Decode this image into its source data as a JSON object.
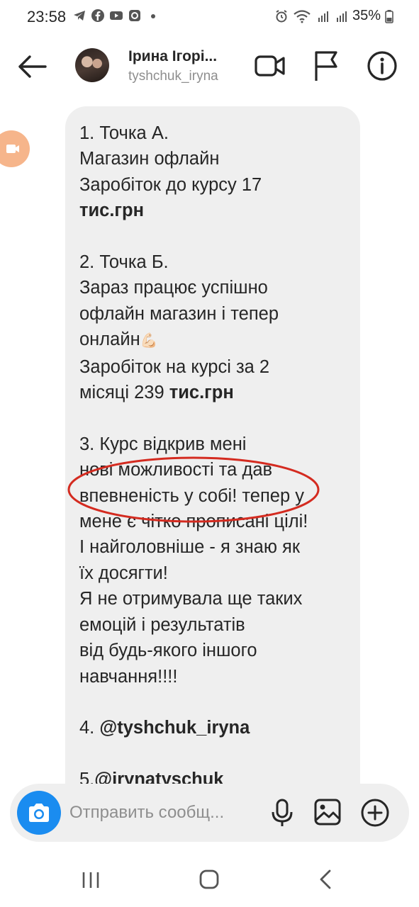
{
  "status_bar": {
    "time": "23:58",
    "battery": "35%"
  },
  "header": {
    "name": "Ірина Ігорі...",
    "handle": "tyshchuk_iryna"
  },
  "message": {
    "p1": {
      "l1": "1. Точка А.",
      "l2": "Магазин офлайн",
      "l3": "Заробіток до курсу 17",
      "l4_bold": "тис.грн"
    },
    "p2": {
      "l1": "2. Точка Б.",
      "l2": "Зараз працює успішно",
      "l3": "офлайн магазин і тепер",
      "l4": "онлайн",
      "l4_emoji": "💪🏻",
      "l5": "Заробіток на курсі за 2",
      "l6": "місяці 239 ",
      "l6_bold": "тис.грн"
    },
    "p3": {
      "l1": "3. Курс відкрив мені",
      "l2": "нові можливості та дав",
      "l3": "впевненість у собі! тепер у",
      "l4": "мене є чітко прописані цілі!",
      "l5": "І найголовніше - я знаю як",
      "l6": "їх досягти!",
      "l7": "Я не отримувала ще таких",
      "l8": "емоцій і результатів",
      "l9": "від будь-якого іншого",
      "l10": "навчання!!!!"
    },
    "p4": {
      "prefix": "4. ",
      "mention": "@tyshchuk_iryna"
    },
    "p5": {
      "prefix": "5.",
      "mention": "@irynatyschuk"
    }
  },
  "composer": {
    "placeholder": "Отправить сообщ..."
  },
  "colors": {
    "accent": "#1a8cf0",
    "bubble": "#efefef",
    "annotation": "#d42b20",
    "call_bubble": "#f6b58b"
  },
  "icons": {
    "back": "arrow-left-icon",
    "video": "video-camera-icon",
    "flag": "flag-icon",
    "info": "info-icon",
    "camera": "camera-icon",
    "mic": "microphone-icon",
    "gallery": "image-icon",
    "plus": "plus-circle-icon"
  }
}
